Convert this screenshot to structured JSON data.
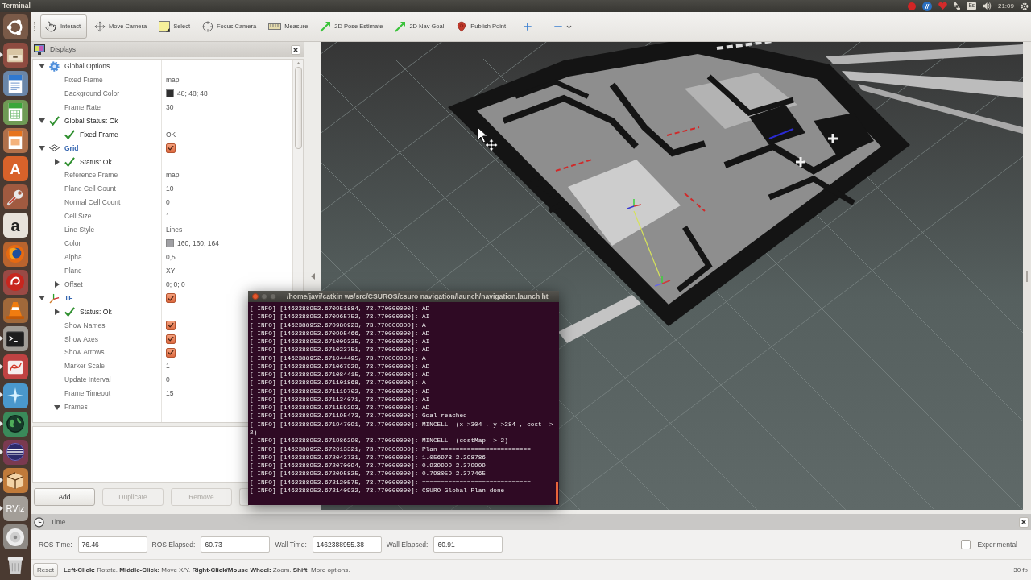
{
  "top_panel": {
    "title": "Terminal",
    "keyboard_layout": "Es",
    "clock": "21:09"
  },
  "launcher": [
    {
      "kind": "dash",
      "running": false
    },
    {
      "kind": "files",
      "running": true
    },
    {
      "kind": "writer",
      "running": false
    },
    {
      "kind": "calc",
      "running": false
    },
    {
      "kind": "impress",
      "running": false
    },
    {
      "kind": "software",
      "label": "A",
      "running": false
    },
    {
      "kind": "tools",
      "running": false
    },
    {
      "kind": "amazon",
      "label": "a",
      "running": false
    },
    {
      "kind": "firefox",
      "running": false
    },
    {
      "kind": "red-app",
      "running": false
    },
    {
      "kind": "vlc",
      "running": false
    },
    {
      "kind": "terminal",
      "running": true
    },
    {
      "kind": "red-circle",
      "running": true
    },
    {
      "kind": "star",
      "running": true
    },
    {
      "kind": "globe",
      "running": true
    },
    {
      "kind": "sphere",
      "running": true
    },
    {
      "kind": "box",
      "running": true
    },
    {
      "kind": "rviz",
      "label": "RViz",
      "running": true
    },
    {
      "kind": "disc",
      "running": false
    },
    {
      "kind": "trash",
      "running": false
    }
  ],
  "toolbar": {
    "tools": [
      {
        "kind": "interact",
        "label": "Interact",
        "selected": true
      },
      {
        "kind": "move-camera",
        "label": "Move Camera",
        "selected": false
      },
      {
        "kind": "select",
        "label": "Select",
        "selected": false
      },
      {
        "kind": "focus-camera",
        "label": "Focus Camera",
        "selected": false
      },
      {
        "kind": "measure",
        "label": "Measure",
        "selected": false
      },
      {
        "kind": "pose-estimate",
        "label": "2D Pose Estimate",
        "selected": false
      },
      {
        "kind": "nav-goal",
        "label": "2D Nav Goal",
        "selected": false
      },
      {
        "kind": "publish-point",
        "label": "Publish Point",
        "selected": false
      }
    ]
  },
  "displays": {
    "title": "Displays",
    "tree": [
      {
        "label": "Global Options",
        "kind": "global-options",
        "expanded": true,
        "children": [
          {
            "label": "Fixed Frame",
            "kind": "property",
            "value": "map"
          },
          {
            "label": "Background Color",
            "kind": "property",
            "value": "48; 48; 48",
            "color": "#303030"
          },
          {
            "label": "Frame Rate",
            "kind": "property",
            "value": "30"
          }
        ]
      },
      {
        "label": "Global Status: Ok",
        "kind": "status",
        "expanded": true,
        "children": [
          {
            "label": "Fixed Frame",
            "kind": "status",
            "value": "OK"
          }
        ]
      },
      {
        "label": "Grid",
        "kind": "grid-display",
        "expanded": true,
        "checked": true,
        "children": [
          {
            "label": "Status: Ok",
            "kind": "status",
            "expanded": false
          },
          {
            "label": "Reference Frame",
            "kind": "property",
            "value": "map"
          },
          {
            "label": "Plane Cell Count",
            "kind": "property",
            "value": "10"
          },
          {
            "label": "Normal Cell Count",
            "kind": "property",
            "value": "0"
          },
          {
            "label": "Cell Size",
            "kind": "property",
            "value": "1"
          },
          {
            "label": "Line Style",
            "kind": "property",
            "value": "Lines"
          },
          {
            "label": "Color",
            "kind": "property",
            "value": "160; 160; 164",
            "color": "#a0a0a4"
          },
          {
            "label": "Alpha",
            "kind": "property",
            "value": "0,5"
          },
          {
            "label": "Plane",
            "kind": "property",
            "value": "XY"
          },
          {
            "label": "Offset",
            "kind": "property",
            "expanded": false,
            "value": "0; 0; 0"
          }
        ]
      },
      {
        "label": "TF",
        "kind": "tf-display",
        "expanded": true,
        "checked": true,
        "children": [
          {
            "label": "Status: Ok",
            "kind": "status",
            "expanded": false
          },
          {
            "label": "Show Names",
            "kind": "property",
            "checked": true
          },
          {
            "label": "Show Axes",
            "kind": "property",
            "checked": true
          },
          {
            "label": "Show Arrows",
            "kind": "property",
            "checked": true
          },
          {
            "label": "Marker Scale",
            "kind": "property",
            "value": "1"
          },
          {
            "label": "Update Interval",
            "kind": "property",
            "value": "0"
          },
          {
            "label": "Frame Timeout",
            "kind": "property",
            "value": "15"
          },
          {
            "label": "Frames",
            "kind": "property",
            "expanded": true
          }
        ]
      }
    ],
    "buttons": [
      {
        "label": "Add",
        "disabled": false
      },
      {
        "label": "Duplicate",
        "disabled": true
      },
      {
        "label": "Remove",
        "disabled": true
      }
    ]
  },
  "terminal": {
    "title": "/home/javi/catkin ws/src/CSUROS/csuro navigation/launch/navigation.launch ht",
    "lines": [
      "[ INFO] [1462388952.670951884, 73.770000000]: AD",
      "[ INFO] [1462388952.670965752, 73.770000000]: AI",
      "[ INFO] [1462388952.670980923, 73.770000000]: A",
      "[ INFO] [1462388952.670995466, 73.770000000]: AD",
      "[ INFO] [1462388952.671009335, 73.770000000]: AI",
      "[ INFO] [1462388952.671023751, 73.770000000]: AD",
      "[ INFO] [1462388952.671044495, 73.770000000]: A",
      "[ INFO] [1462388952.671067929, 73.770000000]: AD",
      "[ INFO] [1462388952.671084415, 73.770000000]: AD",
      "[ INFO] [1462388952.671101868, 73.770000000]: A",
      "[ INFO] [1462388952.671119702, 73.770000000]: AD",
      "[ INFO] [1462388952.671134071, 73.770000000]: AI",
      "[ INFO] [1462388952.671159293, 73.770000000]: AD",
      "[ INFO] [1462388952.671195473, 73.770000000]: Goal reached",
      "[ INFO] [1462388952.671947091, 73.770000000]: MINCELL  (x->304 , y->284 , cost ->",
      "2)",
      "[ INFO] [1462388952.671986290, 73.770000000]: MINCELL  (costMap -> 2)",
      "[ INFO] [1462388952.672013321, 73.770000000]: Plan ========================",
      "[ INFO] [1462388952.672043731, 73.770000000]: 1.056978 2.298786",
      "[ INFO] [1462388952.672070094, 73.770000000]: 0.939999 2.379999",
      "[ INFO] [1462388952.672095825, 73.770000000]: 0.798059 2.377465",
      "[ INFO] [1462388952.672120575, 73.770000000]: =============================",
      "[ INFO] [1462388952.672140932, 73.770000000]: CSURO Global Plan done"
    ]
  },
  "time_panel": {
    "title": "Time",
    "fields": [
      {
        "label": "ROS Time:",
        "value": "76.46"
      },
      {
        "label": "ROS Elapsed:",
        "value": "60.73"
      },
      {
        "label": "Wall Time:",
        "value": "1462388955.38"
      },
      {
        "label": "Wall Elapsed:",
        "value": "60.91"
      }
    ],
    "experimental": {
      "label": "Experimental",
      "checked": false
    }
  },
  "status_bar": {
    "reset": "Reset",
    "help": "**Left-Click:** Rotate. **Middle-Click:** Move X/Y. **Right-Click/Mouse Wheel:** Zoom. **Shift**: More options.",
    "fps": "30 fp"
  }
}
